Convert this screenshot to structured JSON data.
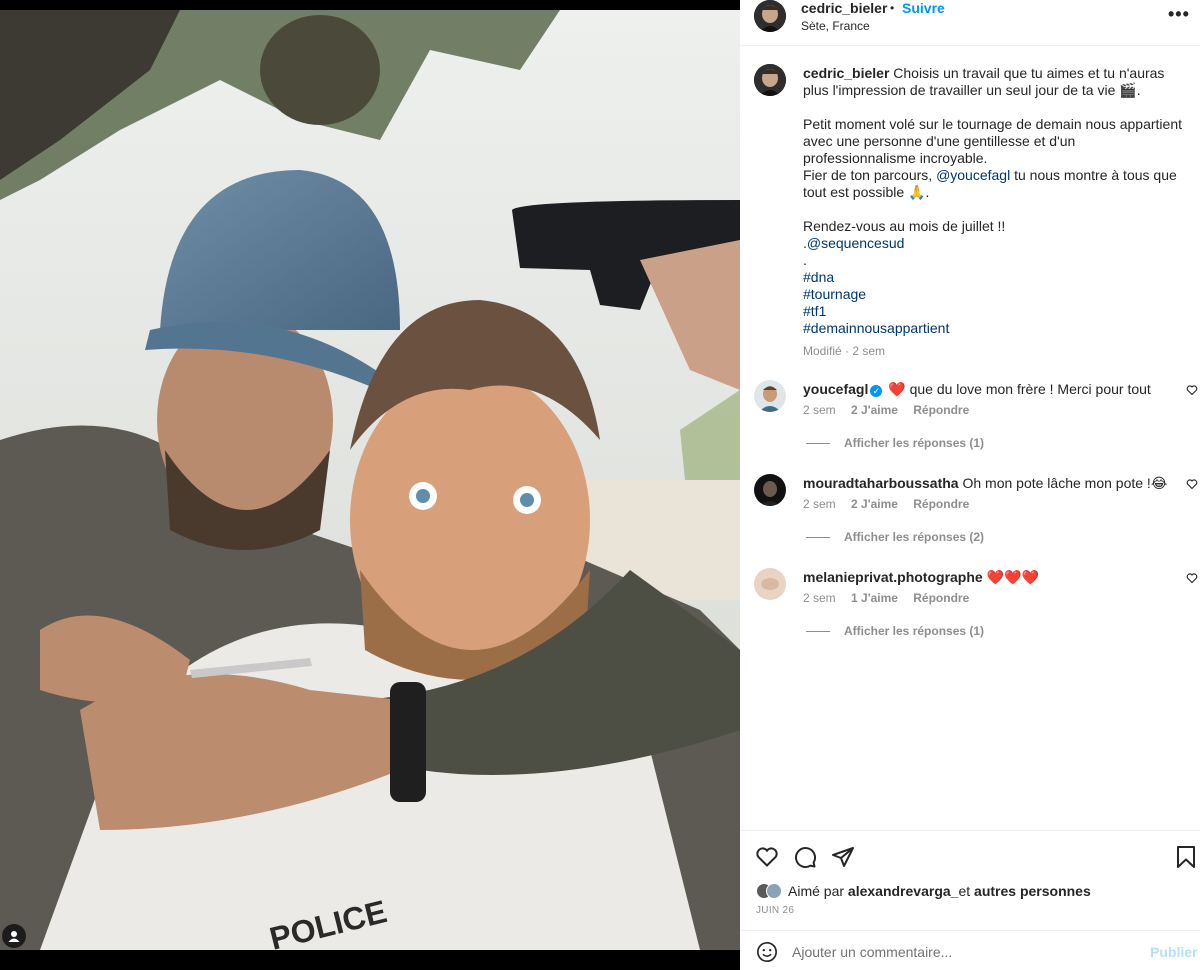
{
  "post": {
    "username": "cedric_bieler",
    "follow_label": "Suivre",
    "separator": "•",
    "location": "Sète, France",
    "more": "•••",
    "photo_badge": "POLICE"
  },
  "caption": {
    "username": "cedric_bieler",
    "line1": "Choisis un travail que tu aimes et tu n'auras plus l'impression de travailler un seul jour de ta vie 🎬.",
    "line2": "Petit moment volé sur le tournage de demain nous appartient avec une personne d'une gentillesse et d'un professionnalisme incroyable.",
    "line3_pre": "Fier de ton parcours, ",
    "line3_mention": "@youcefagl",
    "line3_post": " tu nous montre à tous que tout est possible 🙏.",
    "line4": "Rendez-vous au mois de juillet !!",
    "line5_mention": ".@sequencesud",
    "dot": ".",
    "hashtags": [
      "#dna",
      "#tournage",
      "#tf1",
      "#demainnousappartient"
    ],
    "meta": "Modifié · 2 sem"
  },
  "comments": [
    {
      "username": "youcefagl",
      "verified": true,
      "text": "❤️ que du love mon frère ! Merci pour tout",
      "time": "2 sem",
      "likes": "2 J'aime",
      "reply": "Répondre",
      "view_replies": "Afficher les réponses (1)"
    },
    {
      "username": "mouradtaharboussatha",
      "verified": false,
      "text": "Oh mon pote lâche mon pote !😂",
      "time": "2 sem",
      "likes": "2 J'aime",
      "reply": "Répondre",
      "view_replies": "Afficher les réponses (2)"
    },
    {
      "username": "melanieprivat.photographe",
      "verified": false,
      "text": "❤️❤️❤️",
      "time": "2 sem",
      "likes": "1 J'aime",
      "reply": "Répondre",
      "view_replies": "Afficher les réponses (1)"
    }
  ],
  "footer": {
    "liked_prefix": "Aimé par ",
    "liked_user": "alexandrevarga_",
    "liked_mid": " et ",
    "liked_others": "autres personnes",
    "date": "JUIN 26",
    "comment_placeholder": "Ajouter un commentaire...",
    "post_label": "Publier"
  },
  "icons": [
    "heart-icon",
    "comment-icon",
    "share-icon",
    "bookmark-icon",
    "emoji-icon",
    "more-icon",
    "user-tag-icon"
  ],
  "colors": {
    "accent": "#0095f6",
    "link": "#00376b",
    "muted": "#8e8e8e",
    "heart_red": "#ed4956"
  }
}
